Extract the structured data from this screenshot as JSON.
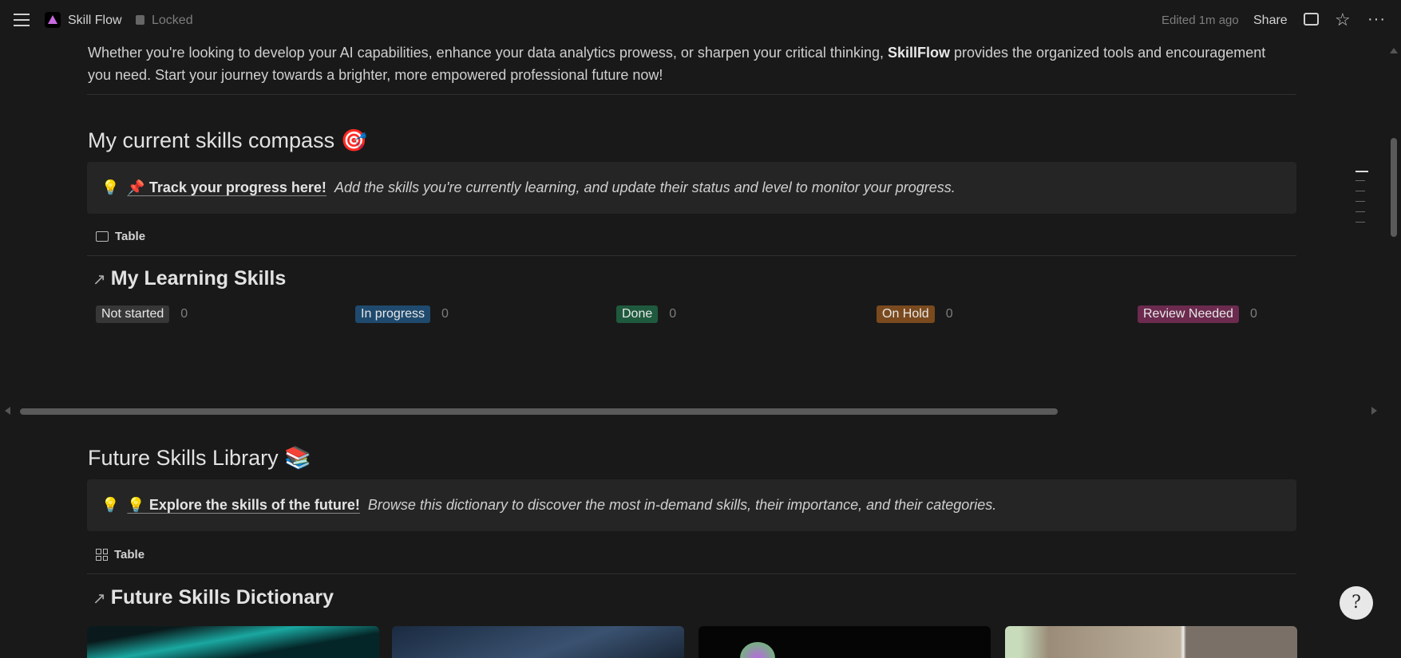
{
  "topbar": {
    "title": "Skill Flow",
    "lock": "Locked",
    "edited": "Edited 1m ago",
    "share": "Share"
  },
  "intro": {
    "before": "Whether you're looking to develop your AI capabilities, enhance your data analytics prowess, or sharpen your critical thinking, ",
    "bold": "SkillFlow",
    "after": " provides the organized tools and encouragement you need. Start your journey towards a brighter, more empowered professional future now!"
  },
  "compass": {
    "heading": "My current skills compass 🎯",
    "callout_emoji": "💡",
    "callout_link": "📌 Track your progress here!",
    "callout_text": "Add the skills you're currently learning, and update their status and level to monitor your progress.",
    "view": "Table",
    "db_title": "My Learning Skills",
    "groups": [
      {
        "label": "Not started",
        "count": "0",
        "color": "#373737"
      },
      {
        "label": "In progress",
        "count": "0",
        "color": "#1f4a6e"
      },
      {
        "label": "Done",
        "count": "0",
        "color": "#1f5a3e"
      },
      {
        "label": "On Hold",
        "count": "0",
        "color": "#7a4a1e"
      },
      {
        "label": "Review Needed",
        "count": "0",
        "color": "#6b2a4e"
      }
    ]
  },
  "library": {
    "heading": "Future Skills Library 📚",
    "callout_emoji": "💡",
    "callout_link": "💡 Explore the skills of the future!",
    "callout_text": "Browse this dictionary to discover the most in-demand skills, their importance, and their categories.",
    "view": "Table",
    "db_title": "Future Skills Dictionary"
  }
}
